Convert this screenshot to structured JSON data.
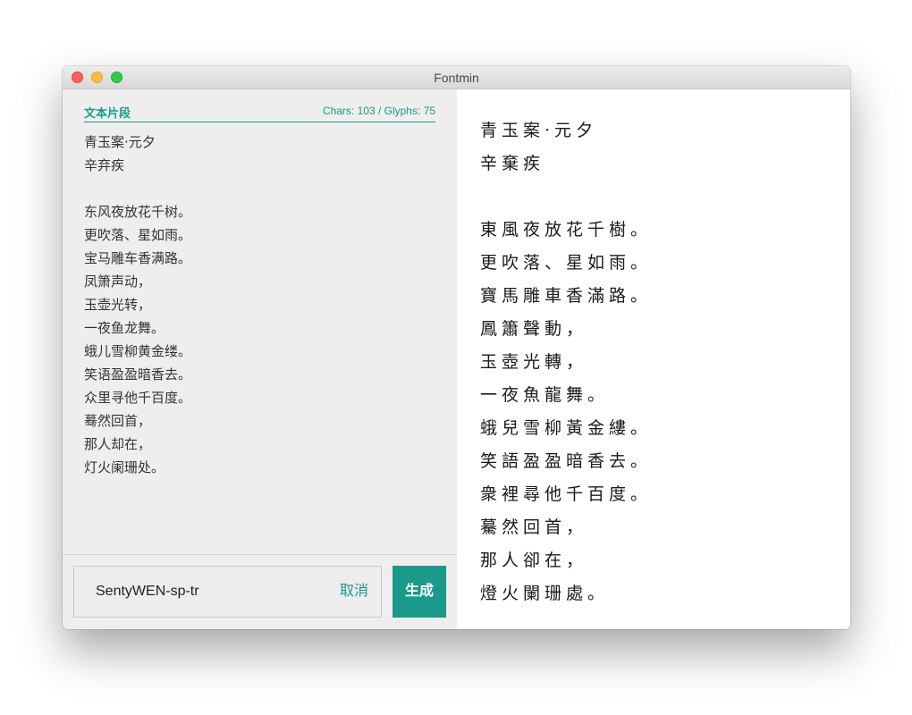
{
  "window": {
    "title": "Fontmin"
  },
  "editor": {
    "label": "文本片段",
    "stats": "Chars: 103 / Glyphs: 75",
    "text": "青玉案·元夕\n辛弃疾\n\n东风夜放花千树。\n更吹落、星如雨。\n宝马雕车香满路。\n凤箫声动，\n玉壶光转，\n一夜鱼龙舞。\n蛾儿雪柳黄金缕。\n笑语盈盈暗香去。\n众里寻他千百度。\n蓦然回首，\n那人却在，\n灯火阑珊处。"
  },
  "footer": {
    "font_name": "SentyWEN-sp-tr",
    "cancel_label": "取消",
    "generate_label": "生成"
  },
  "preview": {
    "text": "青玉案·元夕\n辛棄疾\n\n東風夜放花千樹。\n更吹落、星如雨。\n寶馬雕車香滿路。\n鳳簫聲動，\n玉壺光轉，\n一夜魚龍舞。\n蛾兒雪柳黃金縷。\n笑語盈盈暗香去。\n衆裡尋他千百度。\n驀然回首，\n那人卻在，\n燈火闌珊處。"
  },
  "colors": {
    "accent": "#1a9a8a",
    "left_pane_bg": "#eeeeee",
    "traffic_close": "#fc605b",
    "traffic_minimize": "#fdbc40",
    "traffic_maximize": "#34c84a"
  }
}
